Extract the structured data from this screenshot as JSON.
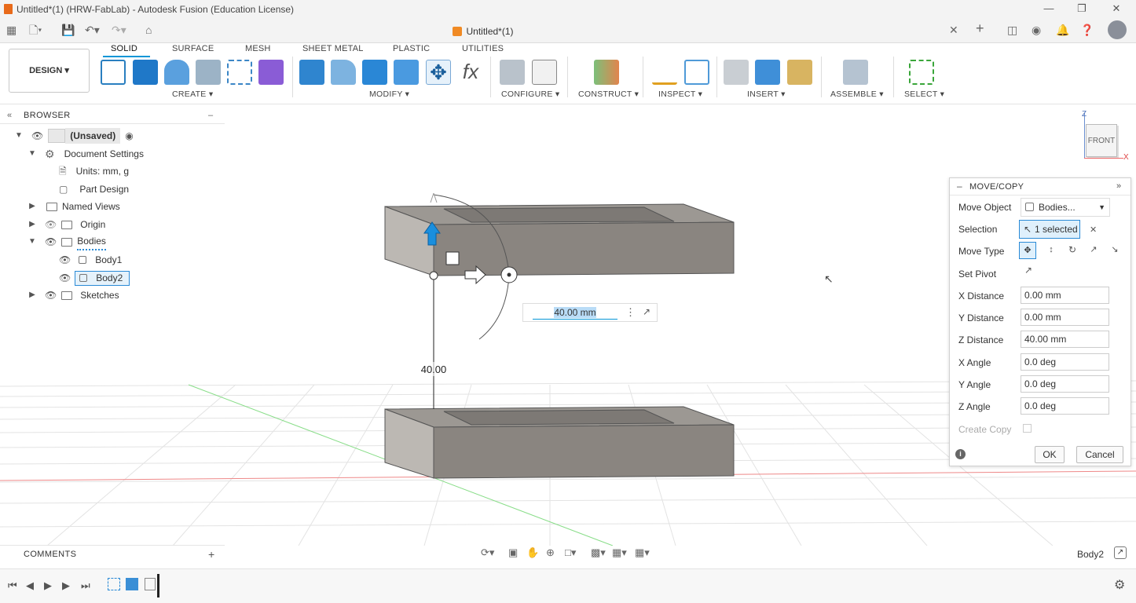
{
  "window": {
    "title": "Untitled*(1) (HRW-FabLab) - Autodesk Fusion (Education License)",
    "doc_tab": "Untitled*(1)"
  },
  "workspace": {
    "label": "DESIGN"
  },
  "ribbon": {
    "tabs": [
      "SOLID",
      "SURFACE",
      "MESH",
      "SHEET METAL",
      "PLASTIC",
      "UTILITIES"
    ],
    "groups": {
      "create": "CREATE",
      "modify": "MODIFY",
      "configure": "CONFIGURE",
      "construct": "CONSTRUCT",
      "inspect": "INSPECT",
      "insert": "INSERT",
      "assemble": "ASSEMBLE",
      "select": "SELECT"
    }
  },
  "browser": {
    "title": "BROWSER",
    "root": "(Unsaved)",
    "items": {
      "doc_settings": "Document Settings",
      "units": "Units: mm, g",
      "part_design": "Part Design",
      "named_views": "Named Views",
      "origin": "Origin",
      "bodies": "Bodies",
      "body1": "Body1",
      "body2": "Body2",
      "sketches": "Sketches"
    }
  },
  "viewcube": {
    "face": "FRONT",
    "z": "Z",
    "x": "X"
  },
  "viewport": {
    "dimension_label": "40.00",
    "input_value": "40.00 mm"
  },
  "move_copy": {
    "title": "MOVE/COPY",
    "labels": {
      "move_object": "Move Object",
      "selection": "Selection",
      "move_type": "Move Type",
      "set_pivot": "Set Pivot",
      "x_distance": "X Distance",
      "y_distance": "Y Distance",
      "z_distance": "Z Distance",
      "x_angle": "X Angle",
      "y_angle": "Y Angle",
      "z_angle": "Z Angle",
      "create_copy": "Create Copy"
    },
    "values": {
      "move_object": "Bodies...",
      "selection": "1 selected",
      "x_distance": "0.00 mm",
      "y_distance": "0.00 mm",
      "z_distance": "40.00 mm",
      "x_angle": "0.0 deg",
      "y_angle": "0.0 deg",
      "z_angle": "0.0 deg"
    },
    "ok": "OK",
    "cancel": "Cancel"
  },
  "comments": {
    "title": "COMMENTS"
  },
  "status": {
    "selected_body": "Body2"
  },
  "colors": {
    "accent": "#0696d7",
    "body": "#8a8580",
    "body_dark": "#6e6a66"
  }
}
